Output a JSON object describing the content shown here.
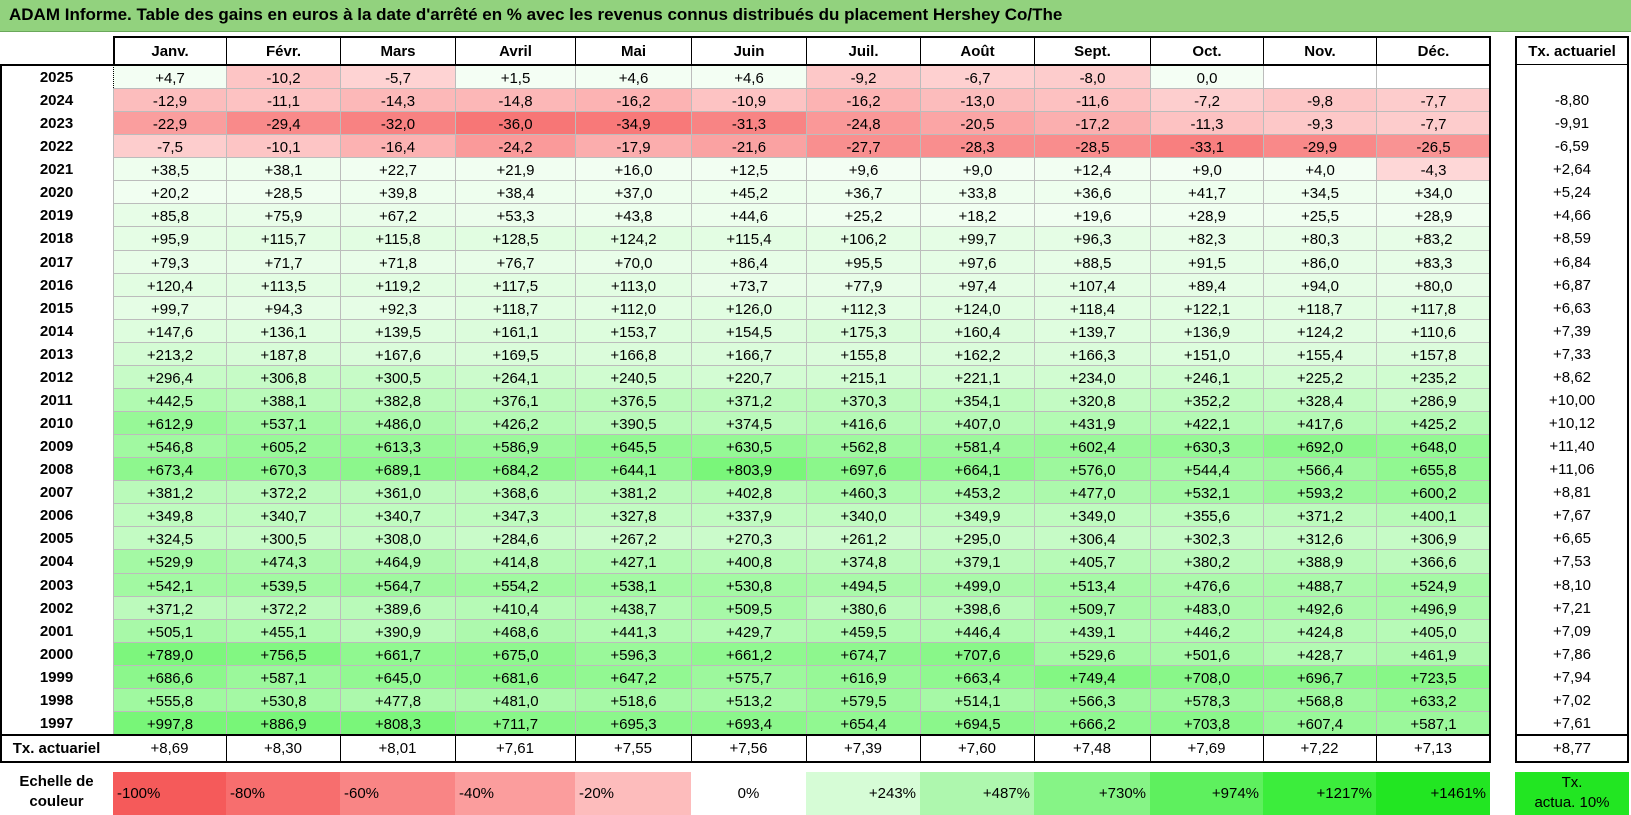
{
  "title": "ADAM Informe. Table des gains en euros à la date d'arrêté en % avec les revenus connus distribués du placement Hershey Co/The",
  "months": [
    "Janv.",
    "Févr.",
    "Mars",
    "Avril",
    "Mai",
    "Juin",
    "Juil.",
    "Août",
    "Sept.",
    "Oct.",
    "Nov.",
    "Déc."
  ],
  "rate_header": "Tx. actuariel",
  "rows": [
    {
      "year": "2025",
      "values": [
        "+4,7",
        "-10,2",
        "-5,7",
        "+1,5",
        "+4,6",
        "+4,6",
        "-9,2",
        "-6,7",
        "-8,0",
        "0,0",
        "",
        ""
      ],
      "rate": ""
    },
    {
      "year": "2024",
      "values": [
        "-12,9",
        "-11,1",
        "-14,3",
        "-14,8",
        "-16,2",
        "-10,9",
        "-16,2",
        "-13,0",
        "-11,6",
        "-7,2",
        "-9,8",
        "-7,7"
      ],
      "rate": "-8,80"
    },
    {
      "year": "2023",
      "values": [
        "-22,9",
        "-29,4",
        "-32,0",
        "-36,0",
        "-34,9",
        "-31,3",
        "-24,8",
        "-20,5",
        "-17,2",
        "-11,3",
        "-9,3",
        "-7,7"
      ],
      "rate": "-9,91"
    },
    {
      "year": "2022",
      "values": [
        "-7,5",
        "-10,1",
        "-16,4",
        "-24,2",
        "-17,9",
        "-21,6",
        "-27,7",
        "-28,3",
        "-28,5",
        "-33,1",
        "-29,9",
        "-26,5"
      ],
      "rate": "-6,59"
    },
    {
      "year": "2021",
      "values": [
        "+38,5",
        "+38,1",
        "+22,7",
        "+21,9",
        "+16,0",
        "+12,5",
        "+9,6",
        "+9,0",
        "+12,4",
        "+9,0",
        "+4,0",
        "-4,3"
      ],
      "rate": "+2,64"
    },
    {
      "year": "2020",
      "values": [
        "+20,2",
        "+28,5",
        "+39,8",
        "+38,4",
        "+37,0",
        "+45,2",
        "+36,7",
        "+33,8",
        "+36,6",
        "+41,7",
        "+34,5",
        "+34,0"
      ],
      "rate": "+5,24"
    },
    {
      "year": "2019",
      "values": [
        "+85,8",
        "+75,9",
        "+67,2",
        "+53,3",
        "+43,8",
        "+44,6",
        "+25,2",
        "+18,2",
        "+19,6",
        "+28,9",
        "+25,5",
        "+28,9"
      ],
      "rate": "+4,66"
    },
    {
      "year": "2018",
      "values": [
        "+95,9",
        "+115,7",
        "+115,8",
        "+128,5",
        "+124,2",
        "+115,4",
        "+106,2",
        "+99,7",
        "+96,3",
        "+82,3",
        "+80,3",
        "+83,2"
      ],
      "rate": "+8,59"
    },
    {
      "year": "2017",
      "values": [
        "+79,3",
        "+71,7",
        "+71,8",
        "+76,7",
        "+70,0",
        "+86,4",
        "+95,5",
        "+97,6",
        "+88,5",
        "+91,5",
        "+86,0",
        "+83,3"
      ],
      "rate": "+6,84"
    },
    {
      "year": "2016",
      "values": [
        "+120,4",
        "+113,5",
        "+119,2",
        "+117,5",
        "+113,0",
        "+73,7",
        "+77,9",
        "+97,4",
        "+107,4",
        "+89,4",
        "+94,0",
        "+80,0"
      ],
      "rate": "+6,87"
    },
    {
      "year": "2015",
      "values": [
        "+99,7",
        "+94,3",
        "+92,3",
        "+118,7",
        "+112,0",
        "+126,0",
        "+112,3",
        "+124,0",
        "+118,4",
        "+122,1",
        "+118,7",
        "+117,8"
      ],
      "rate": "+6,63"
    },
    {
      "year": "2014",
      "values": [
        "+147,6",
        "+136,1",
        "+139,5",
        "+161,1",
        "+153,7",
        "+154,5",
        "+175,3",
        "+160,4",
        "+139,7",
        "+136,9",
        "+124,2",
        "+110,6"
      ],
      "rate": "+7,39"
    },
    {
      "year": "2013",
      "values": [
        "+213,2",
        "+187,8",
        "+167,6",
        "+169,5",
        "+166,8",
        "+166,7",
        "+155,8",
        "+162,2",
        "+166,3",
        "+151,0",
        "+155,4",
        "+157,8"
      ],
      "rate": "+7,33"
    },
    {
      "year": "2012",
      "values": [
        "+296,4",
        "+306,8",
        "+300,5",
        "+264,1",
        "+240,5",
        "+220,7",
        "+215,1",
        "+221,1",
        "+234,0",
        "+246,1",
        "+225,2",
        "+235,2"
      ],
      "rate": "+8,62"
    },
    {
      "year": "2011",
      "values": [
        "+442,5",
        "+388,1",
        "+382,8",
        "+376,1",
        "+376,5",
        "+371,2",
        "+370,3",
        "+354,1",
        "+320,8",
        "+352,2",
        "+328,4",
        "+286,9"
      ],
      "rate": "+10,00"
    },
    {
      "year": "2010",
      "values": [
        "+612,9",
        "+537,1",
        "+486,0",
        "+426,2",
        "+390,5",
        "+374,5",
        "+416,6",
        "+407,0",
        "+431,9",
        "+422,1",
        "+417,6",
        "+425,2"
      ],
      "rate": "+10,12"
    },
    {
      "year": "2009",
      "values": [
        "+546,8",
        "+605,2",
        "+613,3",
        "+586,9",
        "+645,5",
        "+630,5",
        "+562,8",
        "+581,4",
        "+602,4",
        "+630,3",
        "+692,0",
        "+648,0"
      ],
      "rate": "+11,40"
    },
    {
      "year": "2008",
      "values": [
        "+673,4",
        "+670,3",
        "+689,1",
        "+684,2",
        "+644,1",
        "+803,9",
        "+697,6",
        "+664,1",
        "+576,0",
        "+544,4",
        "+566,4",
        "+655,8"
      ],
      "rate": "+11,06"
    },
    {
      "year": "2007",
      "values": [
        "+381,2",
        "+372,2",
        "+361,0",
        "+368,6",
        "+381,2",
        "+402,8",
        "+460,3",
        "+453,2",
        "+477,0",
        "+532,1",
        "+593,2",
        "+600,2"
      ],
      "rate": "+8,81"
    },
    {
      "year": "2006",
      "values": [
        "+349,8",
        "+340,7",
        "+340,7",
        "+347,3",
        "+327,8",
        "+337,9",
        "+340,0",
        "+349,9",
        "+349,0",
        "+355,6",
        "+371,2",
        "+400,1"
      ],
      "rate": "+7,67"
    },
    {
      "year": "2005",
      "values": [
        "+324,5",
        "+300,5",
        "+308,0",
        "+284,6",
        "+267,2",
        "+270,3",
        "+261,2",
        "+295,0",
        "+306,4",
        "+302,3",
        "+312,6",
        "+306,9"
      ],
      "rate": "+6,65"
    },
    {
      "year": "2004",
      "values": [
        "+529,9",
        "+474,3",
        "+464,9",
        "+414,8",
        "+427,1",
        "+400,8",
        "+374,8",
        "+379,1",
        "+405,7",
        "+380,2",
        "+388,9",
        "+366,6"
      ],
      "rate": "+7,53"
    },
    {
      "year": "2003",
      "values": [
        "+542,1",
        "+539,5",
        "+564,7",
        "+554,2",
        "+538,1",
        "+530,8",
        "+494,5",
        "+499,0",
        "+513,4",
        "+476,6",
        "+488,7",
        "+524,9"
      ],
      "rate": "+8,10"
    },
    {
      "year": "2002",
      "values": [
        "+371,2",
        "+372,2",
        "+389,6",
        "+410,4",
        "+438,7",
        "+509,5",
        "+380,6",
        "+398,6",
        "+509,7",
        "+483,0",
        "+492,6",
        "+496,9"
      ],
      "rate": "+7,21"
    },
    {
      "year": "2001",
      "values": [
        "+505,1",
        "+455,1",
        "+390,9",
        "+468,6",
        "+441,3",
        "+429,7",
        "+459,5",
        "+446,4",
        "+439,1",
        "+446,2",
        "+424,8",
        "+405,0"
      ],
      "rate": "+7,09"
    },
    {
      "year": "2000",
      "values": [
        "+789,0",
        "+756,5",
        "+661,7",
        "+675,0",
        "+596,3",
        "+661,2",
        "+674,7",
        "+707,6",
        "+529,6",
        "+501,6",
        "+428,7",
        "+461,9"
      ],
      "rate": "+7,86"
    },
    {
      "year": "1999",
      "values": [
        "+686,6",
        "+587,1",
        "+645,0",
        "+681,6",
        "+647,2",
        "+575,7",
        "+616,9",
        "+663,4",
        "+749,4",
        "+708,0",
        "+696,7",
        "+723,5"
      ],
      "rate": "+7,94"
    },
    {
      "year": "1998",
      "values": [
        "+555,8",
        "+530,8",
        "+477,8",
        "+481,0",
        "+518,6",
        "+513,2",
        "+579,5",
        "+514,1",
        "+566,3",
        "+578,3",
        "+568,8",
        "+633,2"
      ],
      "rate": "+7,02"
    },
    {
      "year": "1997",
      "values": [
        "+997,8",
        "+886,9",
        "+808,3",
        "+711,7",
        "+695,3",
        "+693,4",
        "+654,4",
        "+694,5",
        "+666,2",
        "+703,8",
        "+607,4",
        "+587,1"
      ],
      "rate": "+7,61"
    }
  ],
  "footer": {
    "label": "Tx. actuariel",
    "values": [
      "+8,69",
      "+8,30",
      "+8,01",
      "+7,61",
      "+7,55",
      "+7,56",
      "+7,39",
      "+7,60",
      "+7,48",
      "+7,69",
      "+7,22",
      "+7,13"
    ],
    "total": "+8,77"
  },
  "scale": {
    "label_line1": "Echelle de",
    "label_line2": "couleur",
    "steps": [
      {
        "label": "-100%",
        "color": "#f55a5a",
        "align": "left"
      },
      {
        "label": "-80%",
        "color": "#f76e6e",
        "align": "left"
      },
      {
        "label": "-60%",
        "color": "#f98585",
        "align": "left"
      },
      {
        "label": "-40%",
        "color": "#fb9d9d",
        "align": "left"
      },
      {
        "label": "-20%",
        "color": "#fdbcbc",
        "align": "left"
      },
      {
        "label": "0%",
        "color": "#ffffff",
        "align": "center"
      },
      {
        "label": "+243%",
        "color": "#d6fcd6",
        "align": "right"
      },
      {
        "label": "+487%",
        "color": "#aef7ae",
        "align": "right"
      },
      {
        "label": "+730%",
        "color": "#86f486",
        "align": "right"
      },
      {
        "label": "+974%",
        "color": "#5ef05e",
        "align": "right"
      },
      {
        "label": "+1217%",
        "color": "#3ced3c",
        "align": "right"
      },
      {
        "label": "+1461%",
        "color": "#22e622",
        "align": "right"
      }
    ],
    "badge_line1": "Tx.",
    "badge_line2": "actua. 10%",
    "badge_color": "#22e622"
  },
  "colors": {
    "title_bg": "#92d27e",
    "negative": "#f44a4a",
    "positive": "#19e619"
  }
}
